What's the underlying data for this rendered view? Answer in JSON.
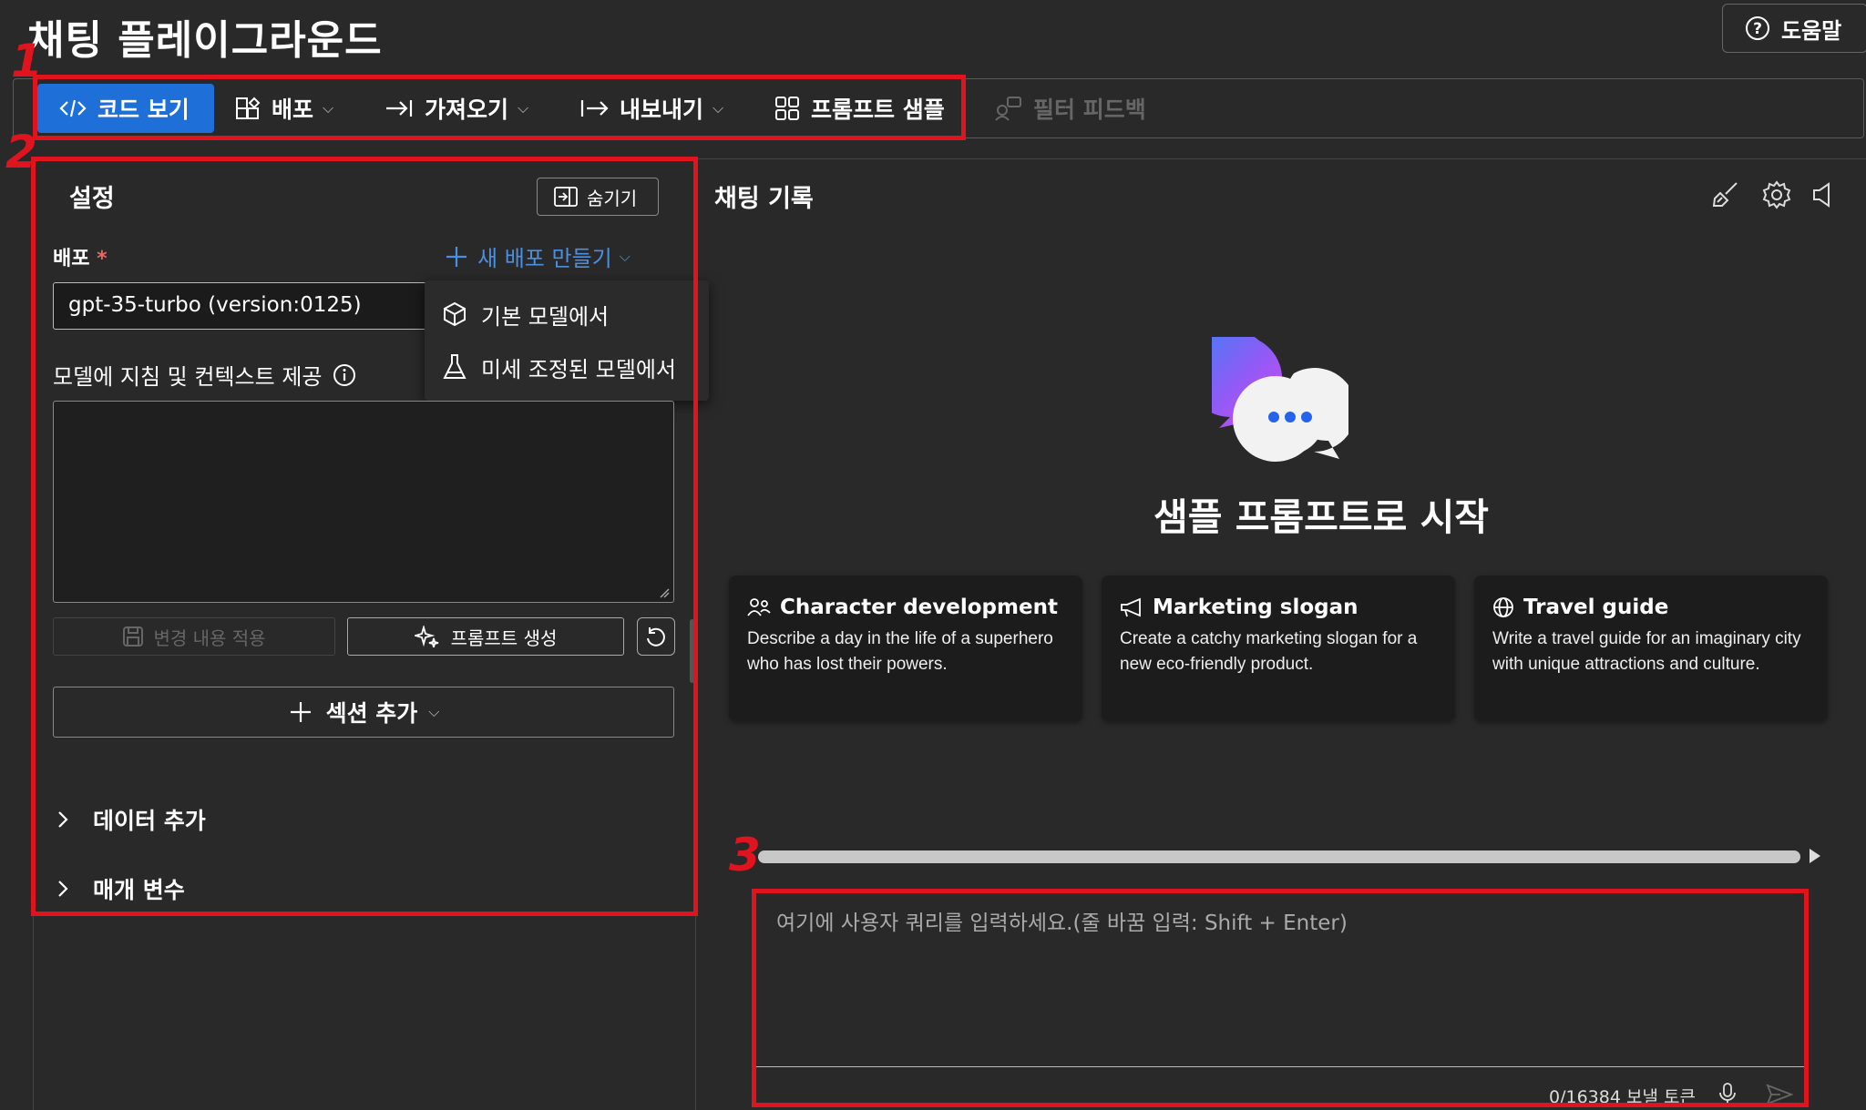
{
  "header": {
    "title": "채팅 플레이그라운드",
    "help_label": "도움말"
  },
  "toolbar": {
    "code_view": "코드 보기",
    "deploy": "배포",
    "import": "가져오기",
    "export": "내보내기",
    "prompt_samples": "프롬프트 샘플",
    "filter_feedback": "필터 피드백"
  },
  "settings": {
    "title": "설정",
    "hide_label": "숨기기",
    "deployment_label": "배포",
    "required_mark": "*",
    "new_deployment": "새 배포 만들기",
    "deployment_value": "gpt-35-turbo (version:0125)",
    "dropdown_items": [
      "기본 모델에서",
      "미세 조정된 모델에서"
    ],
    "system_message_label": "모델에 지침 및 컨텍스트 제공",
    "apply_changes": "변경 내용 적용",
    "generate_prompt": "프롬프트 생성",
    "add_section": "섹션 추가",
    "add_data": "데이터 추가",
    "parameters": "매개 변수"
  },
  "chat": {
    "title": "채팅 기록",
    "empty_title": "샘플 프롬프트로 시작",
    "cards": [
      {
        "title": "Character development",
        "desc": "Describe a day in the life of a superhero who has lost their powers.",
        "icon": "people-icon"
      },
      {
        "title": "Marketing slogan",
        "desc": "Create a catchy marketing slogan for a new eco-friendly product.",
        "icon": "megaphone-icon"
      },
      {
        "title": "Travel guide",
        "desc": "Write a travel guide for an imaginary city with unique attractions and culture.",
        "icon": "globe-icon"
      }
    ],
    "input_placeholder": "여기에 사용자 쿼리를 입력하세요.(줄 바꿈 입력: Shift + Enter)",
    "token_count": "0/16384 보낼 토큰"
  },
  "annotations": [
    "1",
    "2",
    "3"
  ],
  "colors": {
    "accent": "#1f6fd8",
    "link": "#4a90e2",
    "annotation_red": "#e0141e",
    "background": "#292929"
  }
}
